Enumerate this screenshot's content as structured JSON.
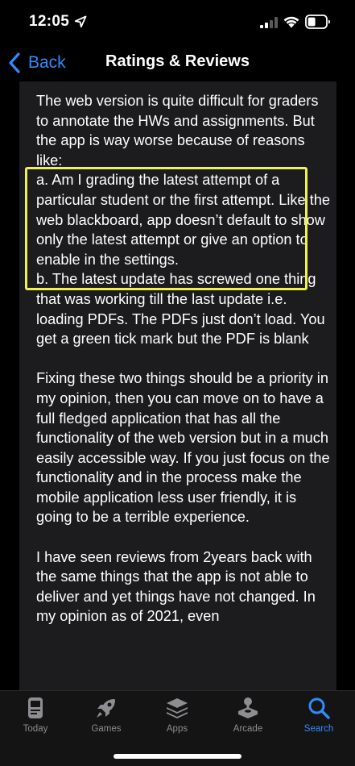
{
  "status_bar": {
    "time": "12:05"
  },
  "nav": {
    "back_label": "Back",
    "title": "Ratings & Reviews"
  },
  "review": {
    "text": "The web version is quite difficult for graders to annotate the HWs and assignments. But the app is way worse because of reasons like:\na. Am I grading the latest attempt of a particular student or the first attempt. Like the web blackboard, app doesn’t default to show only the latest attempt or give an option to enable in the settings.\nb. The latest update has screwed one thing that was working till the last update i.e. loading PDFs. The PDFs just don’t load. You get a green tick mark but the PDF is blank\n\nFixing these two things should be a priority in my opinion, then you can move on to have a full fledged application that has all the functionality of the web version but in a much easily accessible way. If you just focus on the functionality and in the process make the mobile application less user friendly, it is going to be a terrible experience.\n\nI have seen reviews from 2years back with the same things that the app is not able to deliver and yet things have not changed. In my opinion as of 2021, even"
  },
  "tabs": [
    {
      "label": "Today",
      "icon": "today-icon"
    },
    {
      "label": "Games",
      "icon": "rocket-icon"
    },
    {
      "label": "Apps",
      "icon": "apps-stack-icon"
    },
    {
      "label": "Arcade",
      "icon": "joystick-icon"
    },
    {
      "label": "Search",
      "icon": "search-icon",
      "active": true
    }
  ],
  "colors": {
    "accent": "#2f8cff",
    "highlight": "#eef24a",
    "card_background": "#1c1c1e",
    "inactive_tab": "#8d8d92"
  }
}
